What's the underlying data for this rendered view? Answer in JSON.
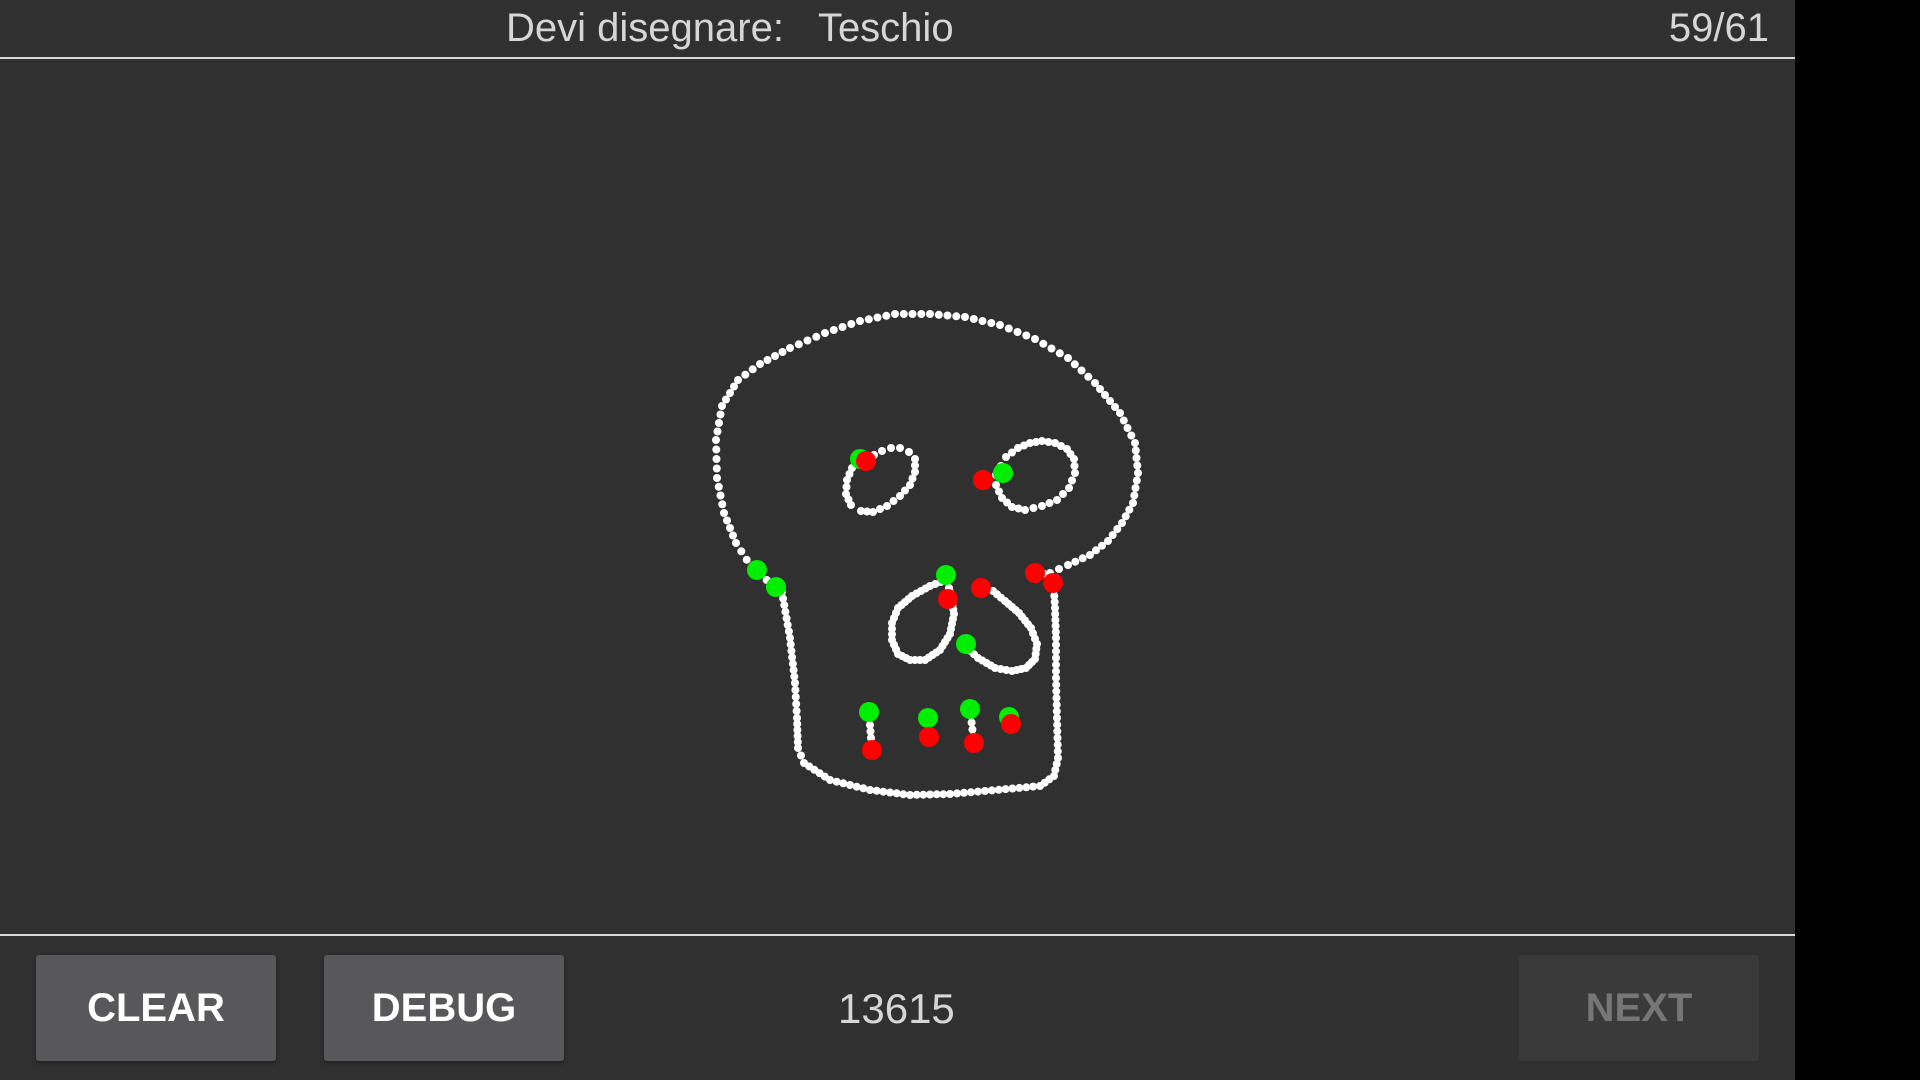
{
  "header": {
    "prompt_label": "Devi disegnare:",
    "target_word": "Teschio",
    "progress": "59/61"
  },
  "footer": {
    "clear_label": "CLEAR",
    "debug_label": "DEBUG",
    "score": "13615",
    "next_label": "NEXT"
  },
  "colors": {
    "background": "#303030",
    "stroke": "#ffffff",
    "stroke_start": "#00ee00",
    "stroke_end": "#ff0000"
  }
}
